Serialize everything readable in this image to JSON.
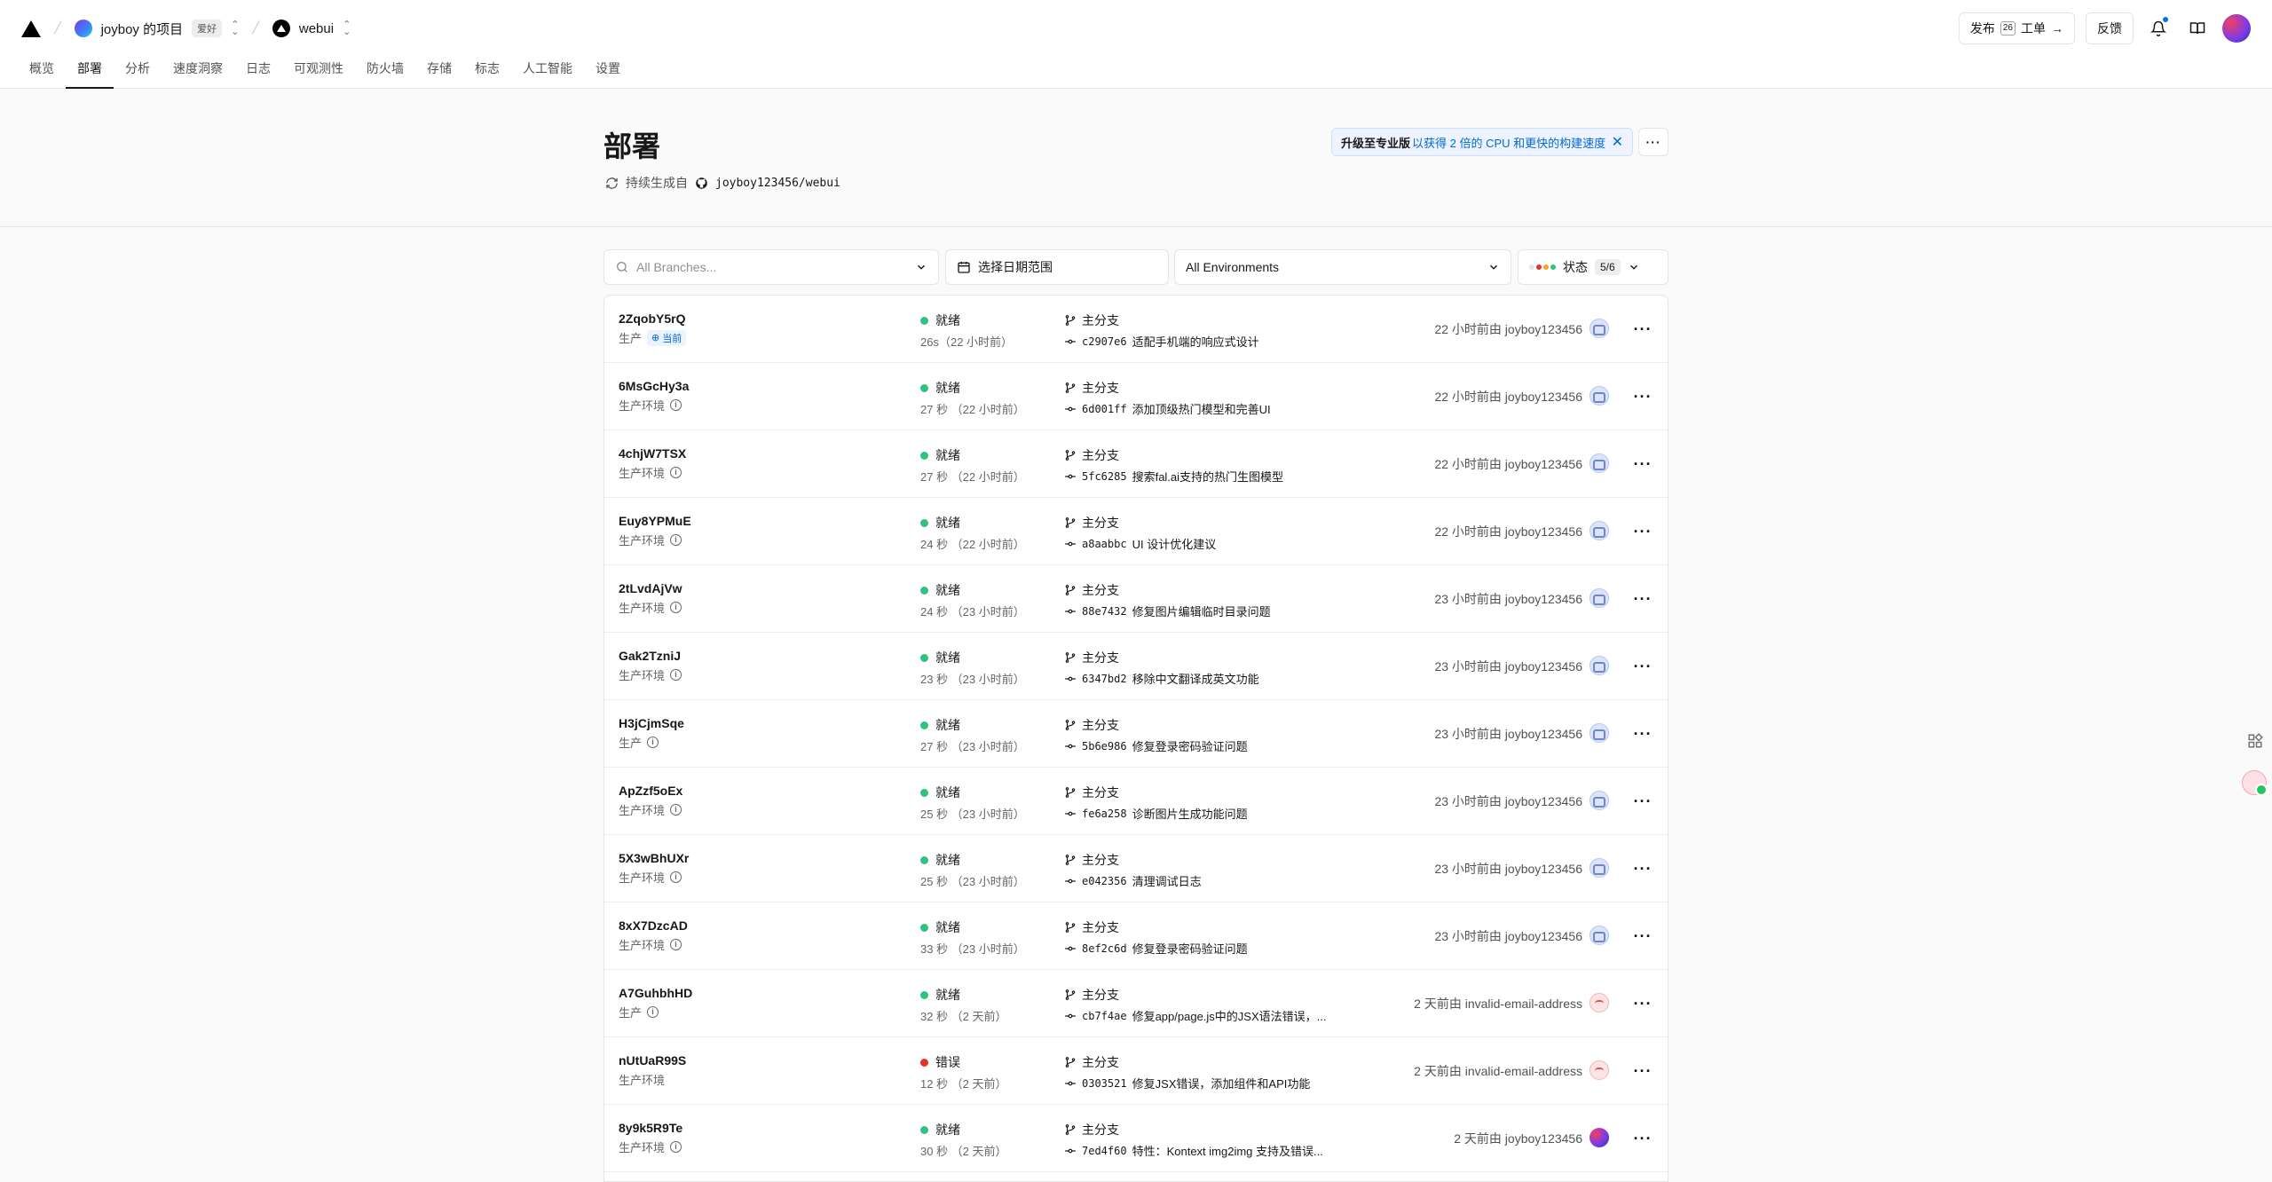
{
  "header": {
    "team_name": "joyboy 的项目",
    "team_plan": "爱好",
    "project_name": "webui",
    "deploy_label": "发布",
    "deploy_kbd": "26",
    "ticket_label": "工单",
    "feedback_label": "反馈"
  },
  "tabs": [
    {
      "label": "概览"
    },
    {
      "label": "部署"
    },
    {
      "label": "分析"
    },
    {
      "label": "速度洞察"
    },
    {
      "label": "日志"
    },
    {
      "label": "可观测性"
    },
    {
      "label": "防火墙"
    },
    {
      "label": "存储"
    },
    {
      "label": "标志"
    },
    {
      "label": "人工智能"
    },
    {
      "label": "设置"
    }
  ],
  "active_tab": "部署",
  "hero": {
    "title": "部署",
    "continuous_label": "持续生成自",
    "repo": "joyboy123456/webui",
    "upgrade_bold": "升级至专业版",
    "upgrade_text": "以获得 2 倍的 CPU 和更快的构建速度"
  },
  "filters": {
    "branch_placeholder": "All Branches...",
    "date_label": "选择日期范围",
    "env_label": "All Environments",
    "status_label": "状态",
    "status_count": "5/6"
  },
  "colors": {
    "ready": "#2ec27e",
    "error": "#e5322d",
    "accent": "#0070f3"
  },
  "deployments": [
    {
      "id": "2ZqobY5rQ",
      "env": "生产",
      "current": true,
      "current_label": "当前",
      "status": "就绪",
      "state": "ready",
      "duration": "26s（22 小时前）",
      "branch": "主分支",
      "hash": "c2907e6",
      "message": "适配手机端的响应式设计",
      "meta": "22 小时前由 joyboy123456",
      "avatar": "bot"
    },
    {
      "id": "6MsGcHy3a",
      "env": "生产环境",
      "status": "就绪",
      "state": "ready",
      "duration": "27 秒 （22 小时前）",
      "branch": "主分支",
      "hash": "6d001ff",
      "message": "添加顶级热门模型和完善UI",
      "meta": "22 小时前由 joyboy123456",
      "avatar": "bot"
    },
    {
      "id": "4chjW7TSX",
      "env": "生产环境",
      "status": "就绪",
      "state": "ready",
      "duration": "27 秒 （22 小时前）",
      "branch": "主分支",
      "hash": "5fc6285",
      "message": "搜索fal.ai支持的热门生图模型",
      "meta": "22 小时前由 joyboy123456",
      "avatar": "bot"
    },
    {
      "id": "Euy8YPMuE",
      "env": "生产环境",
      "status": "就绪",
      "state": "ready",
      "duration": "24 秒 （22 小时前）",
      "branch": "主分支",
      "hash": "a8aabbc",
      "message": "UI 设计优化建议",
      "meta": "22 小时前由 joyboy123456",
      "avatar": "bot"
    },
    {
      "id": "2tLvdAjVw",
      "env": "生产环境",
      "status": "就绪",
      "state": "ready",
      "duration": "24 秒 （23 小时前）",
      "branch": "主分支",
      "hash": "88e7432",
      "message": "修复图片编辑临时目录问题",
      "meta": "23 小时前由 joyboy123456",
      "avatar": "bot"
    },
    {
      "id": "Gak2TzniJ",
      "env": "生产环境",
      "status": "就绪",
      "state": "ready",
      "duration": "23 秒 （23 小时前）",
      "branch": "主分支",
      "hash": "6347bd2",
      "message": "移除中文翻译成英文功能",
      "meta": "23 小时前由 joyboy123456",
      "avatar": "bot"
    },
    {
      "id": "H3jCjmSqe",
      "env": "生产",
      "status": "就绪",
      "state": "ready",
      "duration": "27 秒 （23 小时前）",
      "branch": "主分支",
      "hash": "5b6e986",
      "message": "修复登录密码验证问题",
      "meta": "23 小时前由 joyboy123456",
      "avatar": "bot"
    },
    {
      "id": "ApZzf5oEx",
      "env": "生产环境",
      "status": "就绪",
      "state": "ready",
      "duration": "25 秒 （23 小时前）",
      "branch": "主分支",
      "hash": "fe6a258",
      "message": "诊断图片生成功能问题",
      "meta": "23 小时前由 joyboy123456",
      "avatar": "bot"
    },
    {
      "id": "5X3wBhUXr",
      "env": "生产环境",
      "status": "就绪",
      "state": "ready",
      "duration": "25 秒 （23 小时前）",
      "branch": "主分支",
      "hash": "e042356",
      "message": "清理调试日志",
      "meta": "23 小时前由 joyboy123456",
      "avatar": "bot"
    },
    {
      "id": "8xX7DzcAD",
      "env": "生产环境",
      "status": "就绪",
      "state": "ready",
      "duration": "33 秒 （23 小时前）",
      "branch": "主分支",
      "hash": "8ef2c6d",
      "message": "修复登录密码验证问题",
      "meta": "23 小时前由 joyboy123456",
      "avatar": "bot"
    },
    {
      "id": "A7GuhbhHD",
      "env": "生产",
      "status": "就绪",
      "state": "ready",
      "duration": "32 秒 （2 天前）",
      "branch": "主分支",
      "hash": "cb7f4ae",
      "message": "修复app/page.js中的JSX语法错误，...",
      "meta": "2 天前由 invalid-email-address",
      "avatar": "red"
    },
    {
      "id": "nUtUaR99S",
      "env": "生产环境",
      "no_info": true,
      "status": "错误",
      "state": "error",
      "duration": "12 秒 （2 天前）",
      "branch": "主分支",
      "hash": "0303521",
      "message": "修复JSX错误，添加组件和API功能",
      "meta": "2 天前由 invalid-email-address",
      "avatar": "red"
    },
    {
      "id": "8y9k5R9Te",
      "env": "生产环境",
      "status": "就绪",
      "state": "ready",
      "duration": "30 秒 （2 天前）",
      "branch": "主分支",
      "hash": "7ed4f60",
      "message": "特性：Kontext img2img 支持及错误...",
      "meta": "2 天前由 joyboy123456",
      "avatar": "grad"
    }
  ]
}
